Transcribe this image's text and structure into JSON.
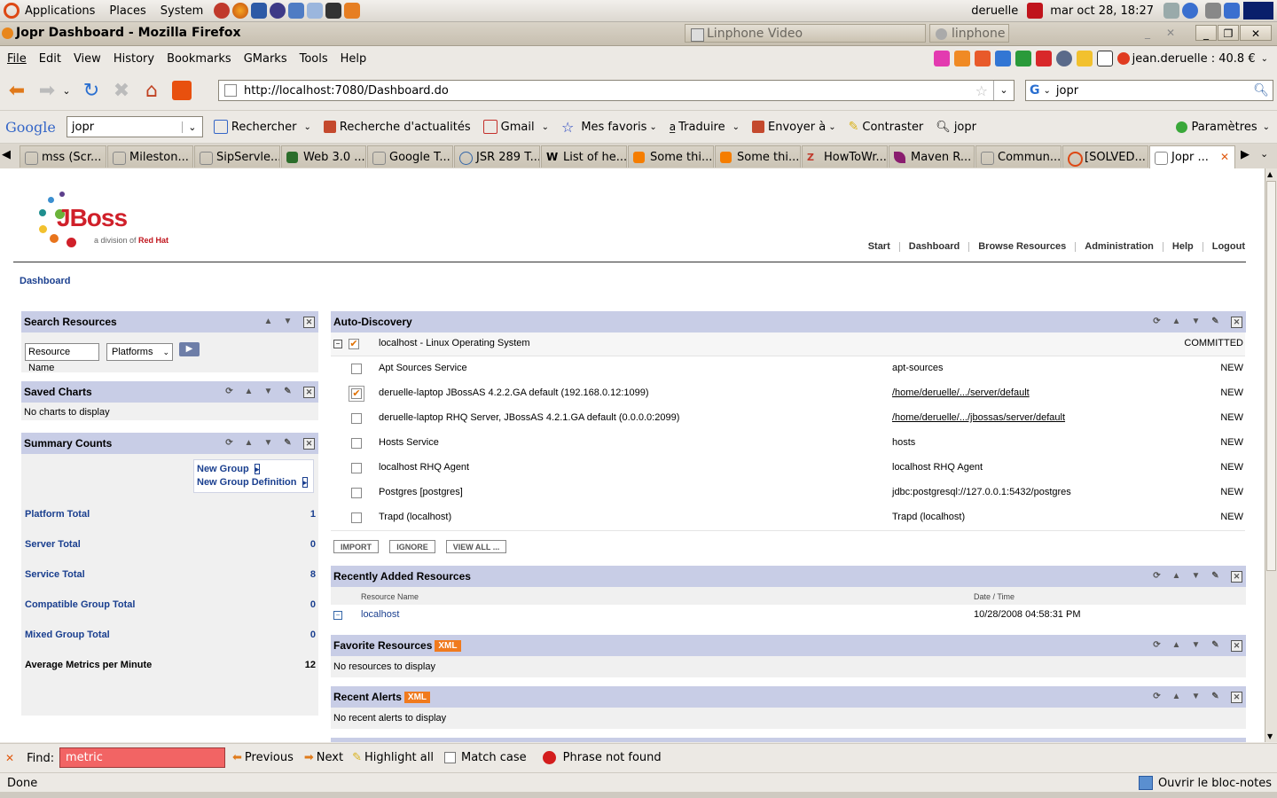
{
  "gnome": {
    "menus": [
      "Applications",
      "Places",
      "System"
    ],
    "user": "deruelle",
    "clock": "mar oct 28, 18:27"
  },
  "window": {
    "title": "Jopr Dashboard - Mozilla Firefox",
    "taskbar": [
      "Linphone Video",
      "linphone"
    ]
  },
  "menubar": {
    "items": [
      "File",
      "Edit",
      "View",
      "History",
      "Bookmarks",
      "GMarks",
      "Tools",
      "Help"
    ],
    "account": "jean.deruelle : 40.8 €"
  },
  "nav": {
    "url": "http://localhost:7080/Dashboard.do",
    "search_value": "jopr"
  },
  "google_toolbar": {
    "logo": "Google",
    "search_value": "jopr",
    "items": [
      "Rechercher",
      "Recherche d'actualités",
      "Gmail",
      "Mes favoris",
      "Traduire",
      "Envoyer à",
      "Contraster",
      "jopr"
    ],
    "settings": "Paramètres"
  },
  "tabs": [
    "mss (Scr...",
    "Mileston...",
    "SipServle...",
    "Web 3.0 ...",
    "Google T...",
    "JSR 289 T...",
    "List of he...",
    "Some thi...",
    "Some thi...",
    "HowToWr...",
    "Maven R...",
    "Commun...",
    "[SOLVED...",
    "Jopr ..."
  ],
  "jboss": {
    "logo_text": "JBoss",
    "logo_sub": "a division of",
    "logo_brand": "Red Hat",
    "nav": [
      "Start",
      "Dashboard",
      "Browse Resources",
      "Administration",
      "Help",
      "Logout"
    ],
    "breadcrumb": "Dashboard"
  },
  "search_resources": {
    "title": "Search Resources",
    "input_value": "Resource Name",
    "select_value": "Platforms"
  },
  "saved_charts": {
    "title": "Saved Charts",
    "empty": "No charts to display"
  },
  "summary": {
    "title": "Summary Counts",
    "new_group": "New Group",
    "new_group_def": "New Group Definition",
    "rows": [
      {
        "label": "Platform Total",
        "value": "1"
      },
      {
        "label": "Server Total",
        "value": "0"
      },
      {
        "label": "Service Total",
        "value": "8"
      },
      {
        "label": "Compatible Group Total",
        "value": "0"
      },
      {
        "label": "Mixed Group Total",
        "value": "0"
      },
      {
        "label": "Average Metrics per Minute",
        "value": "12"
      }
    ]
  },
  "autodiscovery": {
    "title": "Auto-Discovery",
    "platform": "localhost - Linux Operating System",
    "platform_status": "COMMITTED",
    "rows": [
      {
        "name": "Apt Sources Service",
        "path": "apt-sources",
        "status": "NEW",
        "checked": false,
        "link": false
      },
      {
        "name": "deruelle-laptop JBossAS 4.2.2.GA default (192.168.0.12:1099)",
        "path": "/home/deruelle/.../server/default",
        "status": "NEW",
        "checked": true,
        "link": true
      },
      {
        "name": "deruelle-laptop RHQ Server, JBossAS 4.2.1.GA default (0.0.0.0:2099)",
        "path": "/home/deruelle/.../jbossas/server/default",
        "status": "NEW",
        "checked": false,
        "link": true
      },
      {
        "name": "Hosts Service",
        "path": "hosts",
        "status": "NEW",
        "checked": false,
        "link": false
      },
      {
        "name": "localhost RHQ Agent",
        "path": "localhost RHQ Agent",
        "status": "NEW",
        "checked": false,
        "link": false
      },
      {
        "name": "Postgres [postgres]",
        "path": "jdbc:postgresql://127.0.0.1:5432/postgres",
        "status": "NEW",
        "checked": false,
        "link": false
      },
      {
        "name": "Trapd (localhost)",
        "path": "Trapd (localhost)",
        "status": "NEW",
        "checked": false,
        "link": false
      }
    ],
    "buttons": [
      "IMPORT",
      "IGNORE",
      "VIEW ALL ..."
    ]
  },
  "recent_resources": {
    "title": "Recently Added Resources",
    "col_name": "Resource Name",
    "col_time": "Date / Time",
    "row_name": "localhost",
    "row_time": "10/28/2008 04:58:31 PM"
  },
  "favorites": {
    "title": "Favorite Resources",
    "badge": "XML",
    "empty": "No resources to display"
  },
  "alerts": {
    "title": "Recent Alerts",
    "badge": "XML",
    "empty": "No recent alerts to display"
  },
  "findbar": {
    "label": "Find:",
    "value": "metric",
    "previous": "Previous",
    "next": "Next",
    "highlight": "Highlight all",
    "match_case": "Match case",
    "status": "Phrase not found"
  },
  "statusbar": {
    "text": "Done",
    "notepad": "Ouvrir le bloc-notes"
  }
}
